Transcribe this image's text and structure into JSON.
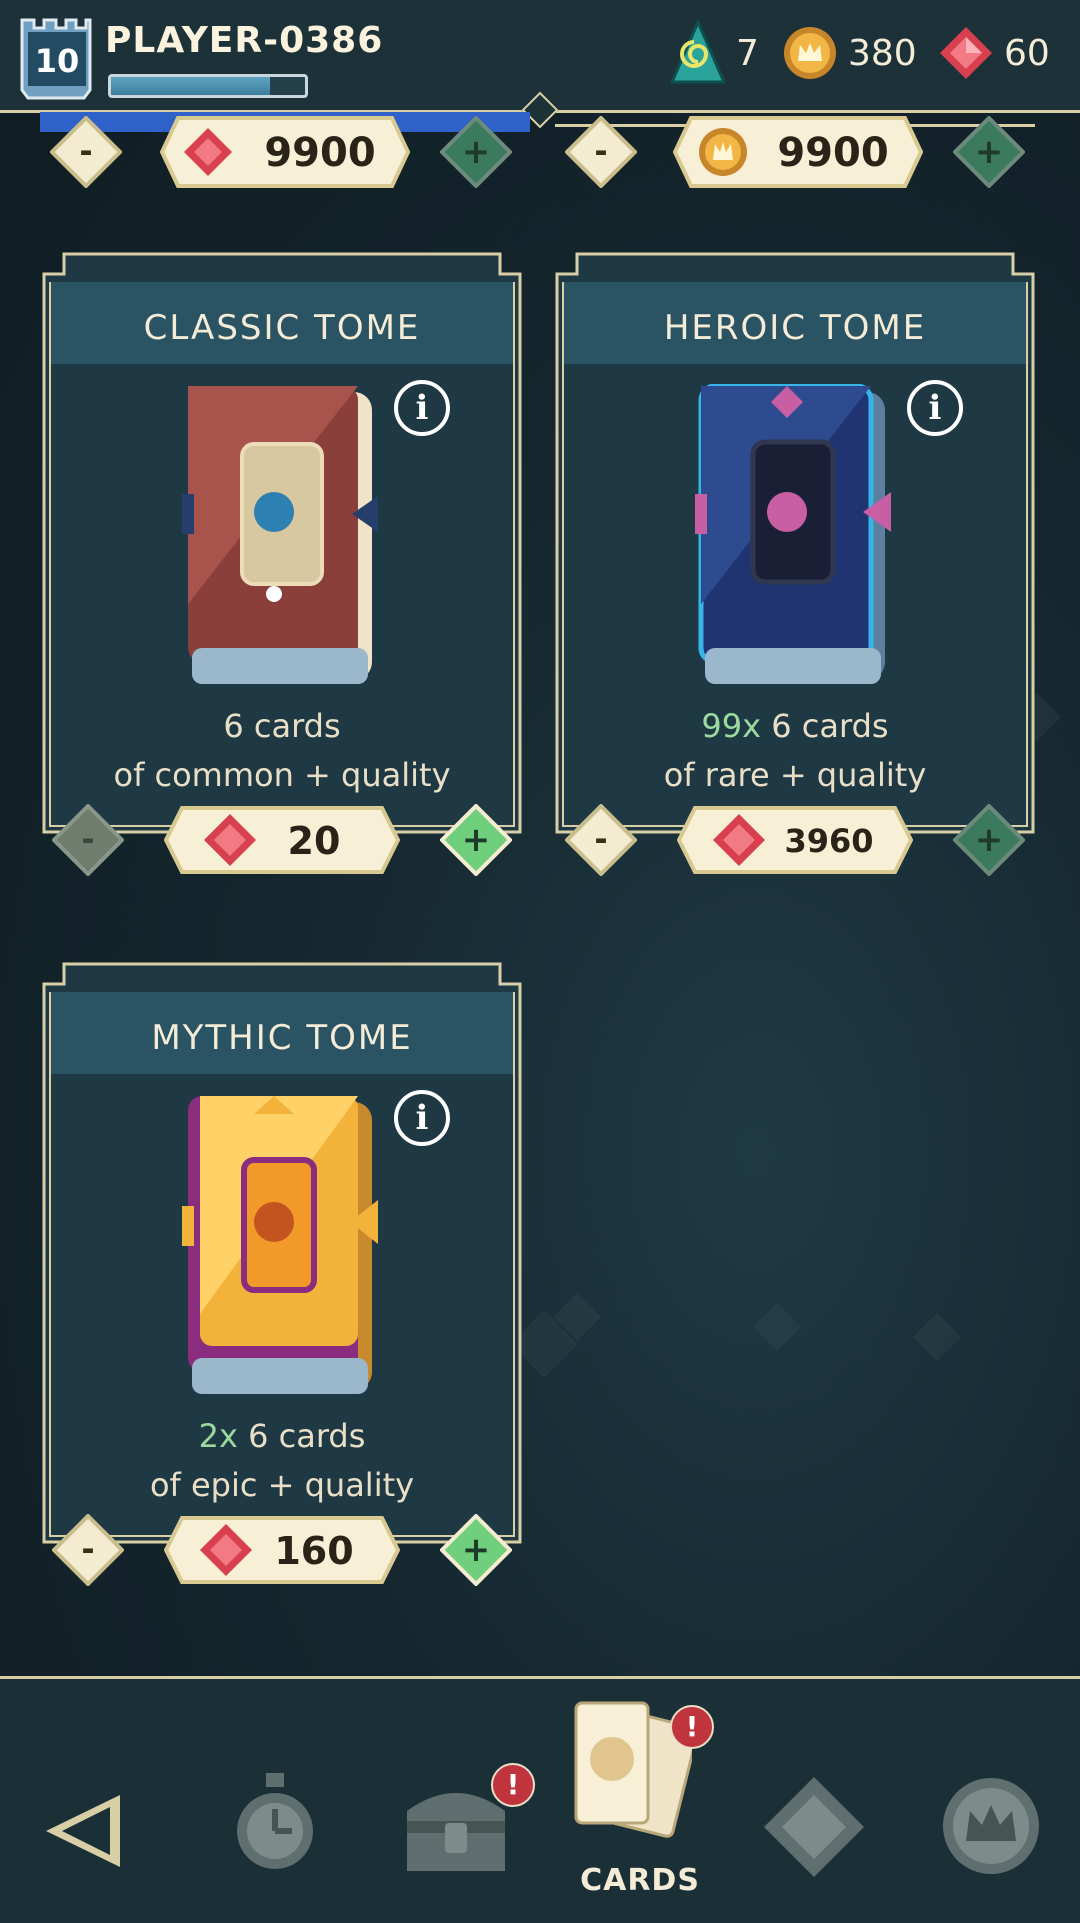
{
  "header": {
    "level": "10",
    "player_name": "PLAYER-0386",
    "xp_progress": 0.82,
    "currencies": [
      {
        "name": "spiral-gem",
        "value": "7"
      },
      {
        "name": "crown-coin",
        "value": "380"
      },
      {
        "name": "ruby",
        "value": "60"
      }
    ]
  },
  "top_row": [
    {
      "currency": "ruby",
      "price": "9900",
      "minus": "-",
      "plus": "+"
    },
    {
      "currency": "crown-coin",
      "price": "9900",
      "minus": "-",
      "plus": "+"
    }
  ],
  "tomes": [
    {
      "title": "CLASSIC TOME",
      "multiplier": "",
      "line1": "6 cards",
      "line2": "of common + quality",
      "price": "20",
      "minus": "-",
      "plus": "+",
      "info": "i"
    },
    {
      "title": "HEROIC TOME",
      "multiplier": "99x",
      "line1": " 6 cards",
      "line2": "of rare + quality",
      "price": "3960",
      "minus": "-",
      "plus": "+",
      "info": "i"
    },
    {
      "title": "MYTHIC TOME",
      "multiplier": "2x",
      "line1": " 6 cards",
      "line2": "of epic + quality",
      "price": "160",
      "minus": "-",
      "plus": "+",
      "info": "i"
    }
  ],
  "nav": {
    "items": [
      {
        "icon": "back-arrow-icon"
      },
      {
        "icon": "stopwatch-icon"
      },
      {
        "icon": "chest-icon",
        "alert": "!"
      },
      {
        "icon": "cards-icon",
        "label": "CARDS",
        "alert": "!"
      },
      {
        "icon": "gem-diamond-icon"
      },
      {
        "icon": "crown-medal-icon"
      }
    ]
  },
  "colors": {
    "accent_green": "#9bd99f",
    "frame": "#d8cfa6",
    "alert": "#c0353d"
  }
}
